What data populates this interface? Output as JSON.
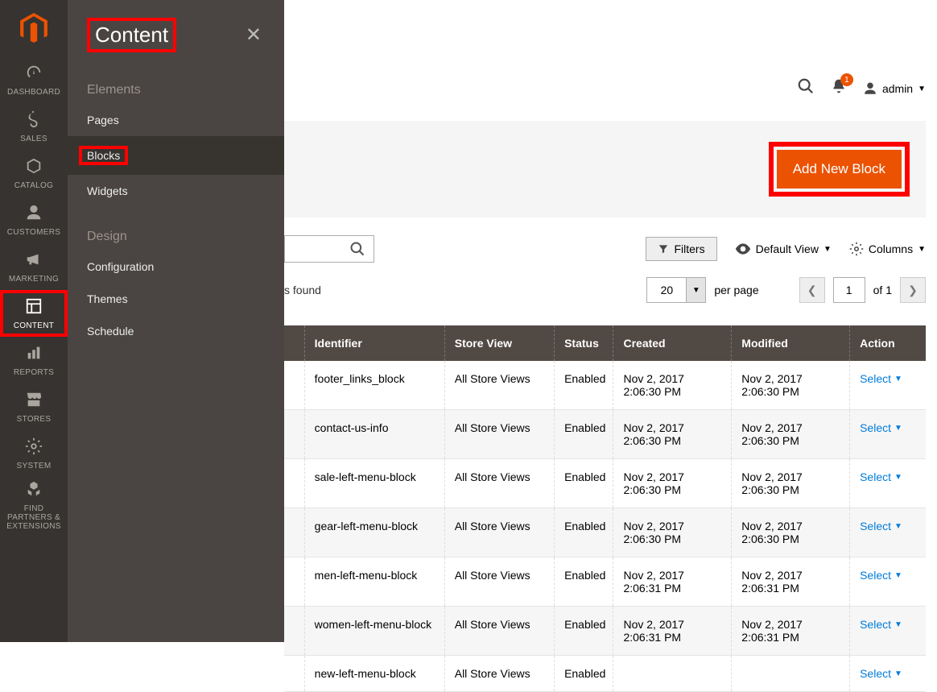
{
  "rail": {
    "items": [
      {
        "key": "dashboard",
        "label": "DASHBOARD",
        "glyph": "speedometer"
      },
      {
        "key": "sales",
        "label": "SALES",
        "glyph": "dollar"
      },
      {
        "key": "catalog",
        "label": "CATALOG",
        "glyph": "box"
      },
      {
        "key": "customers",
        "label": "CUSTOMERS",
        "glyph": "person"
      },
      {
        "key": "marketing",
        "label": "MARKETING",
        "glyph": "megaphone"
      },
      {
        "key": "content",
        "label": "CONTENT",
        "glyph": "layout",
        "active": true,
        "highlight": true
      },
      {
        "key": "reports",
        "label": "REPORTS",
        "glyph": "bars"
      },
      {
        "key": "stores",
        "label": "STORES",
        "glyph": "storefront"
      },
      {
        "key": "system",
        "label": "SYSTEM",
        "glyph": "gear"
      },
      {
        "key": "partners",
        "label": "FIND PARTNERS & EXTENSIONS",
        "glyph": "cubes"
      }
    ]
  },
  "flyout": {
    "title": "Content",
    "sections": [
      {
        "label": "Elements",
        "items": [
          {
            "key": "pages",
            "label": "Pages"
          },
          {
            "key": "blocks",
            "label": "Blocks",
            "active": true,
            "highlight": true
          },
          {
            "key": "widgets",
            "label": "Widgets"
          }
        ]
      },
      {
        "label": "Design",
        "items": [
          {
            "key": "configuration",
            "label": "Configuration"
          },
          {
            "key": "themes",
            "label": "Themes"
          },
          {
            "key": "schedule",
            "label": "Schedule"
          }
        ]
      }
    ]
  },
  "topbar": {
    "notification_count": "1",
    "user_label": "admin"
  },
  "page": {
    "primary_button": "Add New Block"
  },
  "toolbar": {
    "filters_label": "Filters",
    "default_view_label": "Default View",
    "columns_label": "Columns",
    "records_found_text": "s found",
    "per_page_value": "20",
    "per_page_label": "per page",
    "page_current": "1",
    "page_of_label": "of 1"
  },
  "table": {
    "headers": {
      "identifier": "Identifier",
      "store_view": "Store View",
      "status": "Status",
      "created": "Created",
      "modified": "Modified",
      "action": "Action"
    },
    "action_label": "Select",
    "rows": [
      {
        "identifier": "footer_links_block",
        "store_view": "All Store Views",
        "status": "Enabled",
        "created": "Nov 2, 2017 2:06:30 PM",
        "modified": "Nov 2, 2017 2:06:30 PM"
      },
      {
        "identifier": "contact-us-info",
        "store_view": "All Store Views",
        "status": "Enabled",
        "created": "Nov 2, 2017 2:06:30 PM",
        "modified": "Nov 2, 2017 2:06:30 PM"
      },
      {
        "identifier": "sale-left-menu-block",
        "store_view": "All Store Views",
        "status": "Enabled",
        "created": "Nov 2, 2017 2:06:30 PM",
        "modified": "Nov 2, 2017 2:06:30 PM"
      },
      {
        "identifier": "gear-left-menu-block",
        "store_view": "All Store Views",
        "status": "Enabled",
        "created": "Nov 2, 2017 2:06:30 PM",
        "modified": "Nov 2, 2017 2:06:30 PM"
      },
      {
        "identifier": "men-left-menu-block",
        "store_view": "All Store Views",
        "status": "Enabled",
        "created": "Nov 2, 2017 2:06:31 PM",
        "modified": "Nov 2, 2017 2:06:31 PM"
      },
      {
        "identifier": "women-left-menu-block",
        "store_view": "All Store Views",
        "status": "Enabled",
        "created": "Nov 2, 2017 2:06:31 PM",
        "modified": "Nov 2, 2017 2:06:31 PM"
      },
      {
        "identifier": "new-left-menu-block",
        "store_view": "All Store Views",
        "status": "Enabled",
        "created": "",
        "modified": ""
      }
    ]
  }
}
